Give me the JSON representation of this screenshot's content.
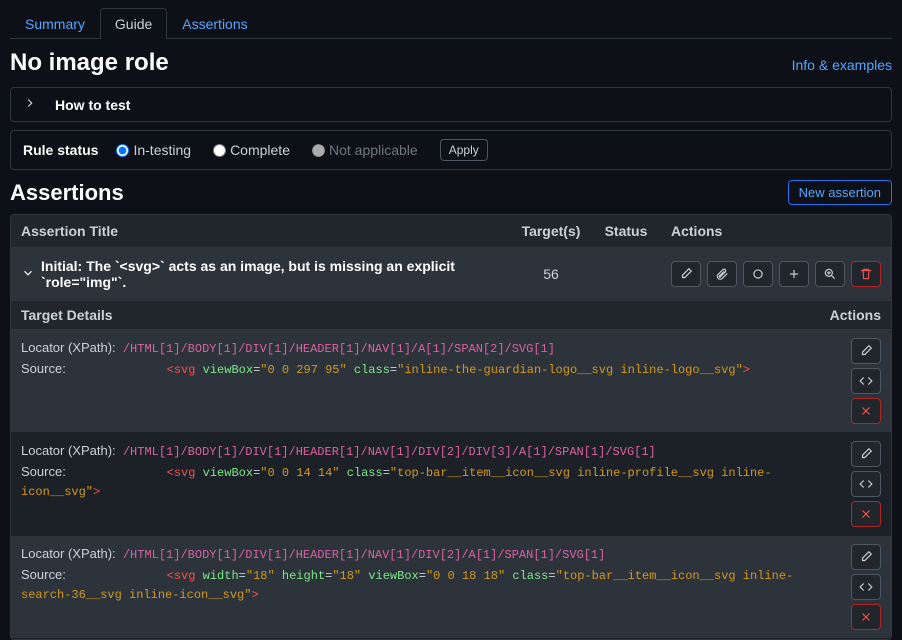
{
  "tabs": {
    "summary": "Summary",
    "guide": "Guide",
    "assertions": "Assertions"
  },
  "title": "No image role",
  "info_link": "Info & examples",
  "how_to_test": "How to test",
  "rule_status_label": "Rule status",
  "radios": {
    "in_testing": "In-testing",
    "complete": "Complete",
    "not_applicable": "Not applicable"
  },
  "apply": "Apply",
  "assertions_heading": "Assertions",
  "new_assertion": "New assertion",
  "cols": {
    "title": "Assertion Title",
    "targets": "Target(s)",
    "status": "Status",
    "actions": "Actions"
  },
  "assertion": {
    "title": "Initial: The `<svg>` acts as an image, but is missing an explicit `role=\"img\"`.",
    "targets": "56"
  },
  "sub": {
    "target_details": "Target Details",
    "actions": "Actions"
  },
  "locator_label": "Locator (XPath):",
  "source_label": "Source:",
  "rows": [
    {
      "xpath": "/HTML[1]/BODY[1]/DIV[1]/HEADER[1]/NAV[1]/A[1]/SPAN[2]/SVG[1]",
      "source_tag": "svg",
      "attrs": [
        {
          "name": "viewBox",
          "value": "0 0 297 95"
        },
        {
          "name": "class",
          "value": "inline-the-guardian-logo__svg inline-logo__svg"
        }
      ]
    },
    {
      "xpath": "/HTML[1]/BODY[1]/DIV[1]/HEADER[1]/NAV[1]/DIV[2]/DIV[3]/A[1]/SPAN[1]/SVG[1]",
      "source_tag": "svg",
      "attrs": [
        {
          "name": "viewBox",
          "value": "0 0 14 14"
        },
        {
          "name": "class",
          "value": "top-bar__item__icon__svg inline-profile__svg inline-icon__svg"
        }
      ]
    },
    {
      "xpath": "/HTML[1]/BODY[1]/DIV[1]/HEADER[1]/NAV[1]/DIV[2]/A[1]/SPAN[1]/SVG[1]",
      "source_tag": "svg",
      "attrs": [
        {
          "name": "width",
          "value": "18"
        },
        {
          "name": "height",
          "value": "18"
        },
        {
          "name": "viewBox",
          "value": "0 0 18 18"
        },
        {
          "name": "class",
          "value": "top-bar__item__icon__svg inline-search-36__svg inline-icon__svg"
        }
      ]
    }
  ]
}
